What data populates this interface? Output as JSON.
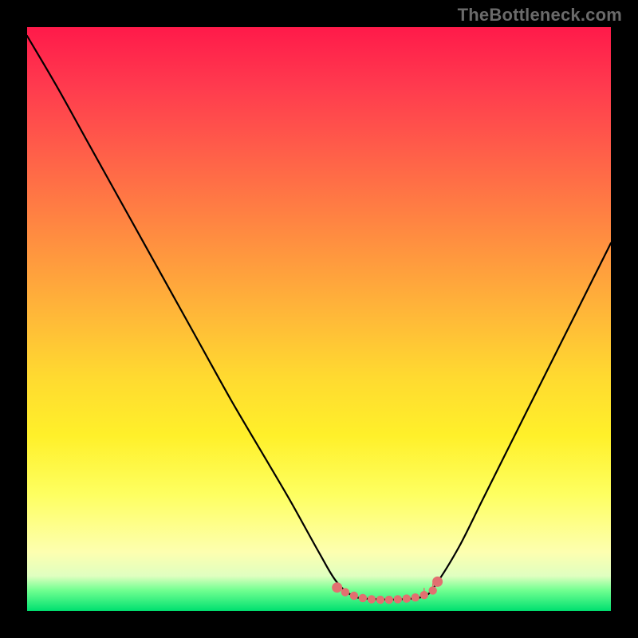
{
  "watermark": "TheBottleneck.com",
  "colors": {
    "background": "#000000",
    "gradient_stops": [
      "#ff1a4a",
      "#ff7a44",
      "#ffda30",
      "#feff60",
      "#00e070"
    ],
    "curve": "#000000",
    "marker": "#e27070"
  },
  "chart_data": {
    "type": "line",
    "title": "",
    "xlabel": "",
    "ylabel": "",
    "xlim": [
      0,
      1
    ],
    "ylim": [
      0,
      1
    ],
    "x": [
      0.0,
      0.05,
      0.1,
      0.15,
      0.2,
      0.25,
      0.3,
      0.35,
      0.4,
      0.45,
      0.5,
      0.53,
      0.56,
      0.6,
      0.64,
      0.68,
      0.7,
      0.74,
      0.78,
      0.82,
      0.86,
      0.9,
      0.94,
      0.97,
      1.0
    ],
    "values": [
      0.985,
      0.9,
      0.81,
      0.72,
      0.63,
      0.54,
      0.45,
      0.36,
      0.275,
      0.19,
      0.1,
      0.05,
      0.025,
      0.02,
      0.02,
      0.025,
      0.045,
      0.11,
      0.19,
      0.27,
      0.35,
      0.43,
      0.51,
      0.57,
      0.63
    ],
    "markers": {
      "x": [
        0.531,
        0.545,
        0.56,
        0.575,
        0.59,
        0.605,
        0.62,
        0.635,
        0.65,
        0.665,
        0.68,
        0.695,
        0.703
      ],
      "values": [
        0.04,
        0.032,
        0.026,
        0.022,
        0.02,
        0.019,
        0.019,
        0.02,
        0.021,
        0.023,
        0.027,
        0.035,
        0.05
      ]
    }
  }
}
